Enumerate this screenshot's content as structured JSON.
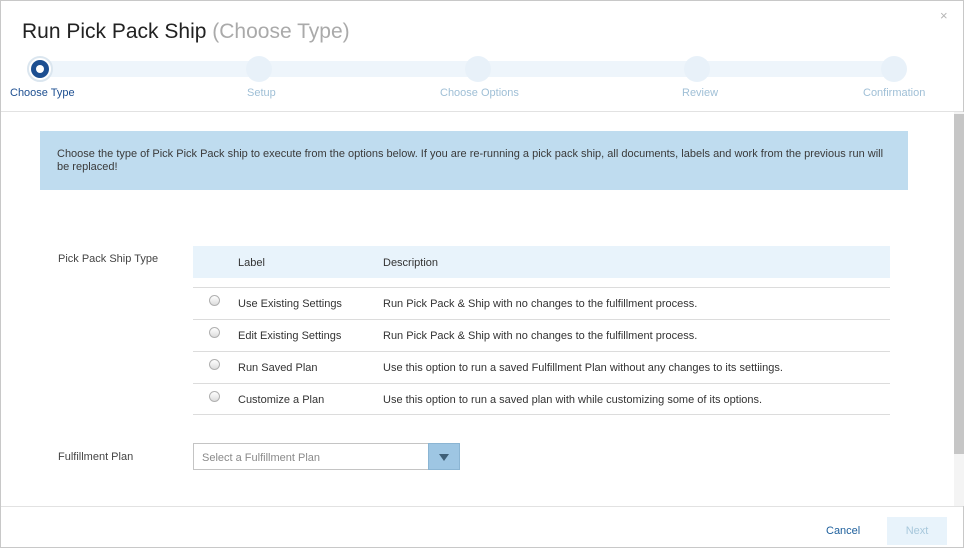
{
  "dialog": {
    "title": "Run Pick Pack Ship",
    "subtitle": "(Choose Type)",
    "close_glyph": "×"
  },
  "steps": [
    {
      "label": "Choose Type",
      "active": true
    },
    {
      "label": "Setup",
      "active": false
    },
    {
      "label": "Choose Options",
      "active": false
    },
    {
      "label": "Review",
      "active": false
    },
    {
      "label": "Confirmation",
      "active": false
    }
  ],
  "info_text": "Choose the type of Pick Pick Pack ship to execute from the options below. If you are re-running a pick pack ship, all documents, labels and work from the previous run will be replaced!",
  "type_field": {
    "label": "Pick Pack Ship Type",
    "columns": {
      "label": "Label",
      "description": "Description"
    },
    "rows": [
      {
        "label": "Use Existing Settings",
        "description": "Run Pick Pack & Ship with no changes to the fulfillment process.",
        "selected": false
      },
      {
        "label": "Edit Existing Settings",
        "description": "Run Pick Pack & Ship with no changes to the fulfillment process.",
        "selected": false
      },
      {
        "label": "Run Saved Plan",
        "description": "Use this option to run a saved Fulfillment Plan without any changes to its settiings.",
        "selected": false
      },
      {
        "label": "Customize a Plan",
        "description": "Use this option to run a saved plan with while customizing some of its options.",
        "selected": false
      }
    ]
  },
  "plan_field": {
    "label": "Fulfillment Plan",
    "placeholder": "Select a Fulfillment Plan"
  },
  "footer": {
    "cancel_label": "Cancel",
    "next_label": "Next"
  },
  "colors": {
    "accent": "#1d4f91",
    "info_bg": "#bfdcef",
    "table_header_bg": "#e8f3fb",
    "select_button": "#9ec6e3"
  }
}
